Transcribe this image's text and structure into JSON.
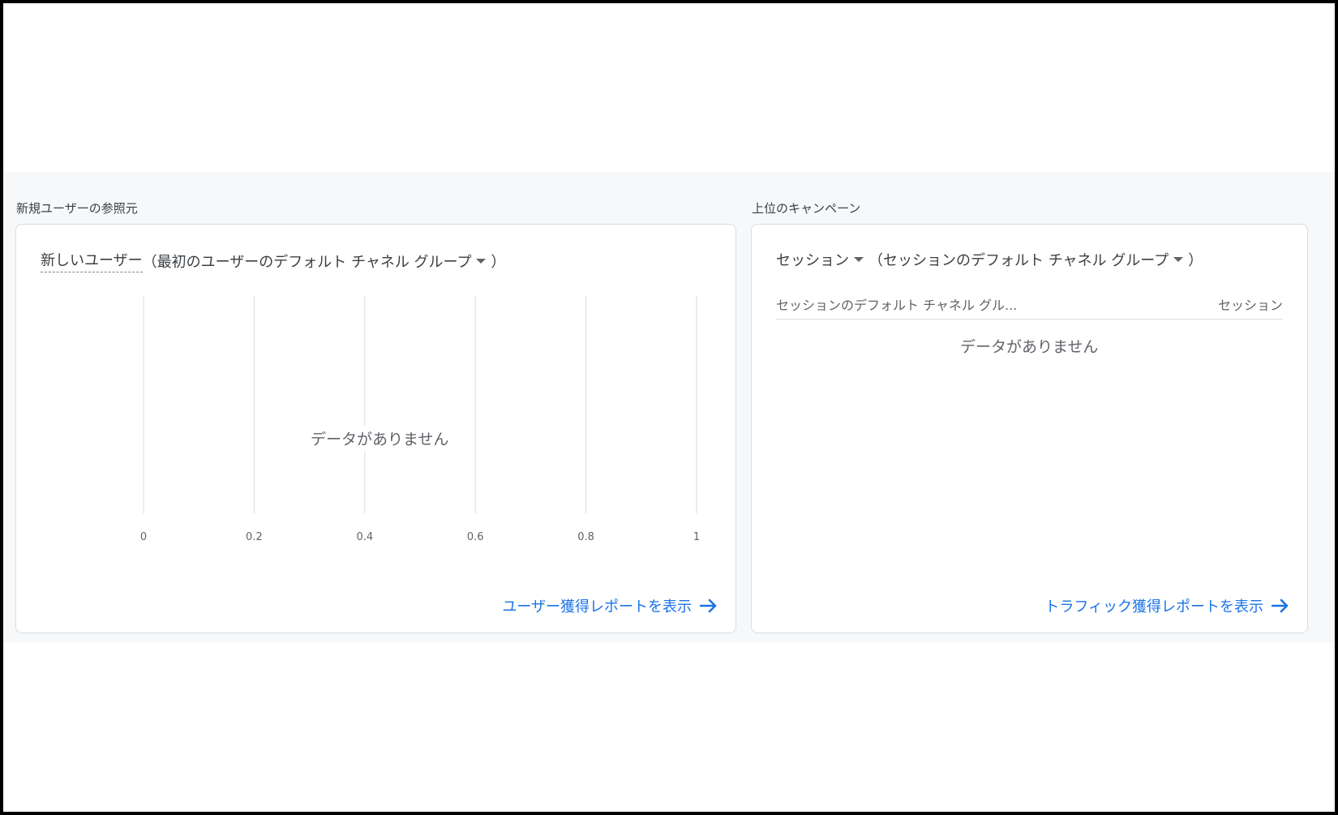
{
  "left_section": {
    "label": "新規ユーザーの参照元",
    "title_metric": "新しいユーザー",
    "title_dimension": "（最初のユーザーのデフォルト チャネル グループ",
    "title_close": "）",
    "no_data": "データがありません",
    "link": "ユーザー獲得レポートを表示",
    "link_icon": "arrow-right-icon"
  },
  "right_section": {
    "label": "上位のキャンペーン",
    "title_metric": "セッション",
    "title_dimension": "（セッションのデフォルト チャネル グループ",
    "title_close": "）",
    "table": {
      "col1": "セッションのデフォルト チャネル グル...",
      "col2": "セッション"
    },
    "no_data": "データがありません",
    "link": "トラフィック獲得レポートを表示",
    "link_icon": "arrow-right-icon"
  },
  "colors": {
    "link": "#1a73e8",
    "grid": "#dadce0"
  },
  "chart_data": {
    "type": "bar",
    "orientation": "horizontal",
    "categories": [],
    "values": [],
    "xlim": [
      0,
      1
    ],
    "xticks": [
      "0",
      "0.2",
      "0.4",
      "0.6",
      "0.8",
      "1"
    ],
    "grid": true,
    "no_data_label": "データがありません"
  }
}
